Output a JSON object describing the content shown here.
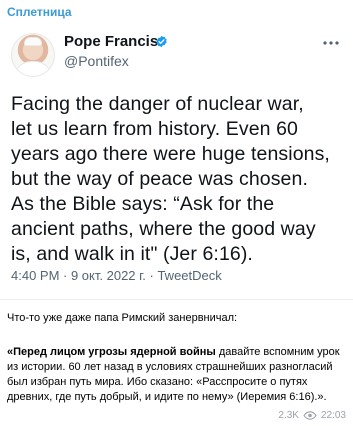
{
  "channel": {
    "name": "Сплетница"
  },
  "tweet": {
    "display_name": "Pope Francis",
    "handle": "@Pontifex",
    "text": "Facing the danger of nuclear war,\nlet us learn from history. Even 60\nyears ago there were huge tensions,\nbut the way of peace was chosen.\nAs the Bible says: “Ask for the\nancient paths, where the good way\nis, and walk in it\" (Jer 6:16).",
    "meta": "4:40 PM · 9 окт. 2022 г. · TweetDeck"
  },
  "message": {
    "intro": "Что-то уже даже папа Римский занервничал:",
    "bold_lead": "«Перед лицом угрозы ядерной войны",
    "rest": " давайте вспомним урок из истории. 60 лет назад в условиях страшнейших разногласий был избран путь мира. Ибо сказано: «Расспросите о путях древних, где путь добрый, и идите по нему» (Иеремия 6:16).»."
  },
  "footer": {
    "views": "2.3K",
    "time": "22:03"
  },
  "colors": {
    "channel_name": "#3a9bd6",
    "verified_badge": "#1d9bf0",
    "tweet_text": "#0f1419",
    "muted": "#536471"
  },
  "icons": {
    "verified": "verified-badge-icon",
    "more": "more-options-icon",
    "views": "eye-icon"
  }
}
